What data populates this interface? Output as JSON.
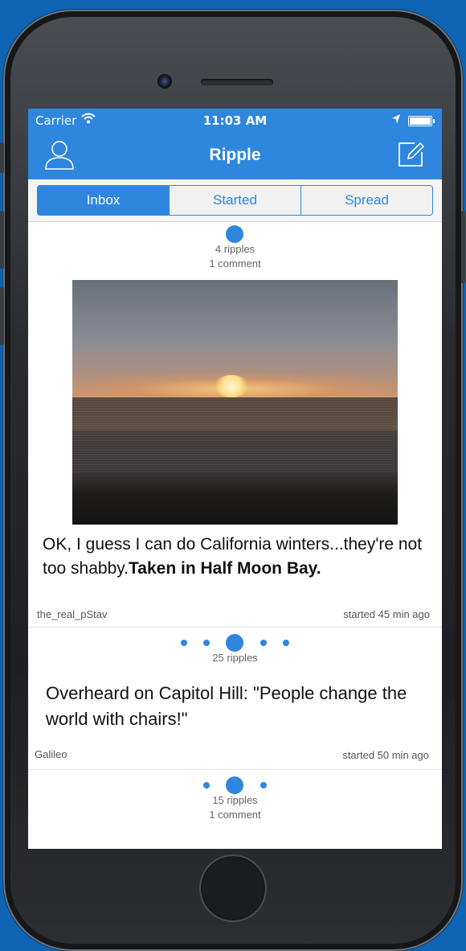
{
  "status_bar": {
    "carrier": "Carrier",
    "time": "11:03 AM"
  },
  "nav": {
    "title": "Ripple"
  },
  "tabs": [
    {
      "label": "Inbox",
      "active": true
    },
    {
      "label": "Started",
      "active": false
    },
    {
      "label": "Spread",
      "active": false
    }
  ],
  "posts": [
    {
      "ripples": "4 ripples",
      "comments": "1 comment",
      "text_plain": "OK, I guess I can do California winters...they're not too shabby.",
      "text_bold": "Taken in Half Moon Bay.",
      "author": "the_real_pStav",
      "started": "started 45 min ago"
    },
    {
      "ripples": "25 ripples",
      "text_plain": "Overheard on Capitol Hill: \"People change the world with chairs!\"",
      "author": "Galileo",
      "started": "started 50 min ago"
    },
    {
      "ripples": "15 ripples",
      "comments": "1 comment"
    }
  ],
  "colors": {
    "accent": "#2e86de",
    "background": "#0f65b4"
  },
  "icons": [
    "wifi-icon",
    "location-arrow-icon",
    "battery-icon",
    "user-icon",
    "compose-icon"
  ]
}
